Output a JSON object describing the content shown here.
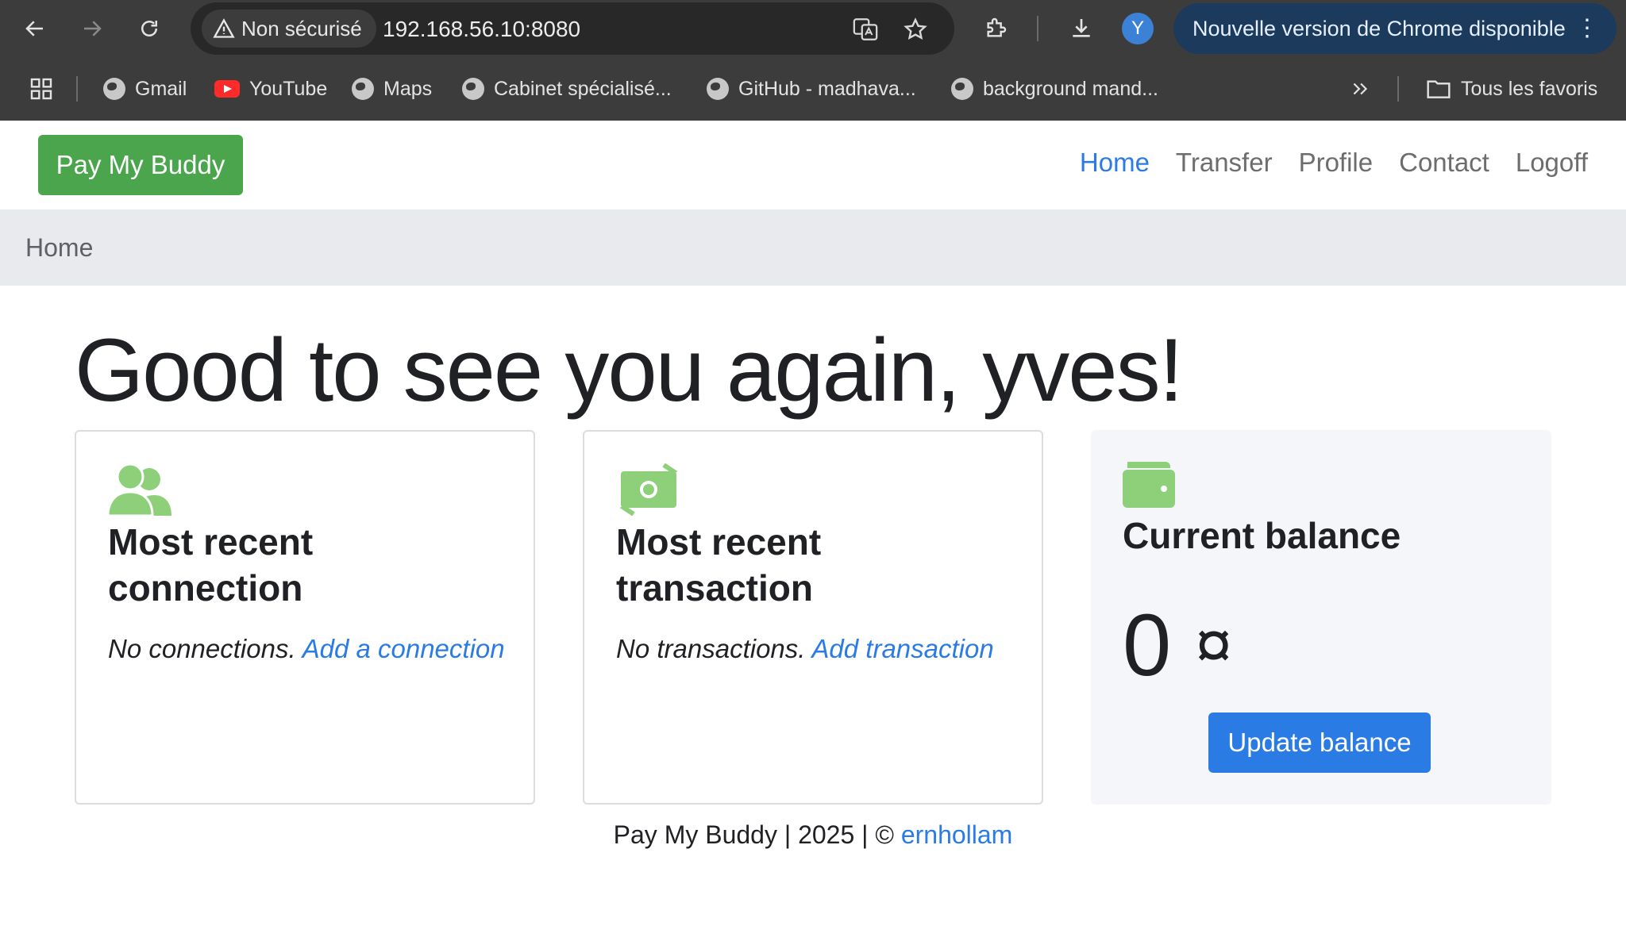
{
  "browser": {
    "security_label": "Non sécurisé",
    "url": "192.168.56.10:8080",
    "avatar_letter": "Y",
    "update_banner": "Nouvelle version de Chrome disponible",
    "bookmarks": [
      "Gmail",
      "YouTube",
      "Maps",
      "Cabinet spécialisé...",
      "GitHub - madhava...",
      "background mand..."
    ],
    "all_bookmarks": "Tous les favoris"
  },
  "navbar": {
    "brand": "Pay My Buddy",
    "links": [
      "Home",
      "Transfer",
      "Profile",
      "Contact",
      "Logoff"
    ],
    "active": "Home"
  },
  "breadcrumb": "Home",
  "greeting": "Good to see you again, yves!",
  "cards": {
    "connection": {
      "title": "Most recent connection",
      "text": "No connections.",
      "link": "Add a connection"
    },
    "transaction": {
      "title": "Most recent transaction",
      "text": "No transactions.",
      "link": "Add transaction"
    },
    "balance": {
      "title": "Current balance",
      "value": "0",
      "currency": "¤",
      "button": "Update balance"
    }
  },
  "footer": {
    "text": "Pay My Buddy | 2025 | ©",
    "link": "ernhollam"
  },
  "colors": {
    "brand_green": "#4aa54d",
    "icon_green": "#8ed07a",
    "primary_blue": "#2a7be4"
  }
}
